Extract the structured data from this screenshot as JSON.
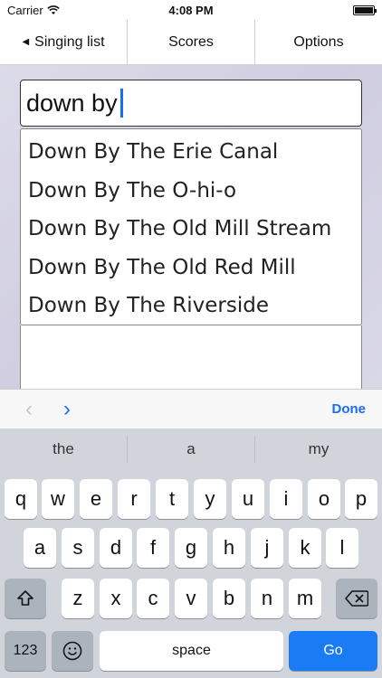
{
  "status_bar": {
    "carrier": "Carrier",
    "time": "4:08 PM"
  },
  "toolbar": {
    "back_label": "Singing list",
    "scores_label": "Scores",
    "options_label": "Options"
  },
  "search": {
    "value": "down by"
  },
  "suggestions": [
    "Down By The Erie Canal",
    "Down By The O-hi-o",
    "Down By The Old Mill Stream",
    "Down By The Old Red Mill",
    "Down By The Riverside"
  ],
  "accessory": {
    "prev": "‹",
    "next": "›",
    "done_label": "Done"
  },
  "predictive": [
    "the",
    "a",
    "my"
  ],
  "keyboard": {
    "row1": [
      "q",
      "w",
      "e",
      "r",
      "t",
      "y",
      "u",
      "i",
      "o",
      "p"
    ],
    "row2": [
      "a",
      "s",
      "d",
      "f",
      "g",
      "h",
      "j",
      "k",
      "l"
    ],
    "row3": [
      "z",
      "x",
      "c",
      "v",
      "b",
      "n",
      "m"
    ],
    "numbers_label": "123",
    "space_label": "space",
    "go_label": "Go"
  },
  "colors": {
    "accent": "#1a7cf5",
    "keyboard_bg": "#d1d5db"
  }
}
